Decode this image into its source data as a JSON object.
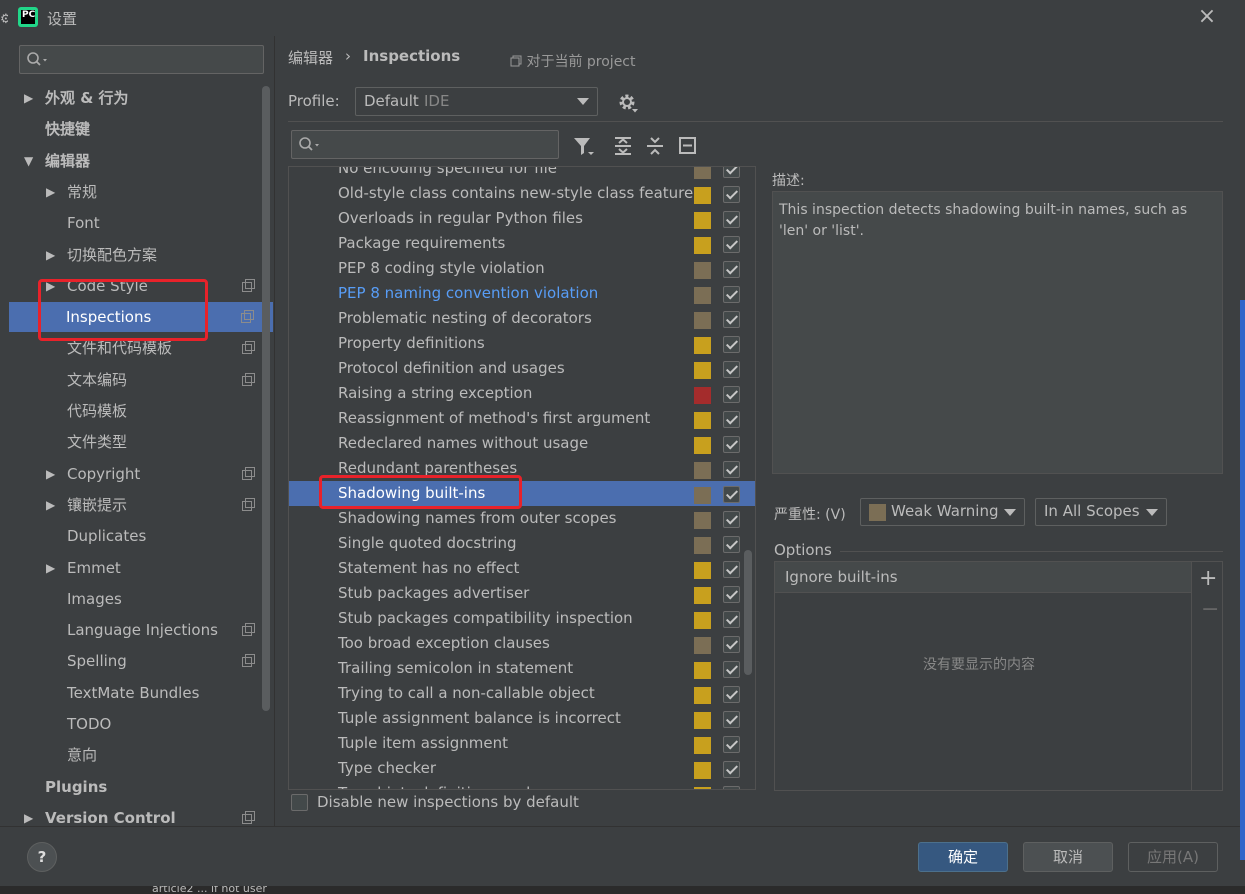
{
  "window": {
    "title": "设置"
  },
  "left": {
    "items": [
      {
        "label": "外观 & 行为",
        "bold": true,
        "arrow": "▶",
        "indent": 0,
        "copy": false
      },
      {
        "label": "快捷键",
        "bold": true,
        "arrow": "",
        "indent": 0,
        "copy": false
      },
      {
        "label": "编辑器",
        "bold": true,
        "arrow": "▼",
        "indent": 0,
        "copy": false
      },
      {
        "label": "常规",
        "bold": false,
        "arrow": "▶",
        "indent": 1,
        "copy": false
      },
      {
        "label": "Font",
        "bold": false,
        "arrow": "",
        "indent": 1,
        "copy": false
      },
      {
        "label": "切换配色方案",
        "bold": false,
        "arrow": "▶",
        "indent": 1,
        "copy": false
      },
      {
        "label": "Code Style",
        "bold": false,
        "arrow": "▶",
        "indent": 1,
        "copy": true
      },
      {
        "label": "Inspections",
        "bold": false,
        "arrow": "",
        "indent": 1,
        "copy": true,
        "selected": true
      },
      {
        "label": "文件和代码模板",
        "bold": false,
        "arrow": "",
        "indent": 1,
        "copy": true
      },
      {
        "label": "文本编码",
        "bold": false,
        "arrow": "",
        "indent": 1,
        "copy": true
      },
      {
        "label": "代码模板",
        "bold": false,
        "arrow": "",
        "indent": 1,
        "copy": false
      },
      {
        "label": "文件类型",
        "bold": false,
        "arrow": "",
        "indent": 1,
        "copy": false
      },
      {
        "label": "Copyright",
        "bold": false,
        "arrow": "▶",
        "indent": 1,
        "copy": true
      },
      {
        "label": "镶嵌提示",
        "bold": false,
        "arrow": "▶",
        "indent": 1,
        "copy": true
      },
      {
        "label": "Duplicates",
        "bold": false,
        "arrow": "",
        "indent": 1,
        "copy": false
      },
      {
        "label": "Emmet",
        "bold": false,
        "arrow": "▶",
        "indent": 1,
        "copy": false
      },
      {
        "label": "Images",
        "bold": false,
        "arrow": "",
        "indent": 1,
        "copy": false
      },
      {
        "label": "Language Injections",
        "bold": false,
        "arrow": "",
        "indent": 1,
        "copy": true
      },
      {
        "label": "Spelling",
        "bold": false,
        "arrow": "",
        "indent": 1,
        "copy": true
      },
      {
        "label": "TextMate Bundles",
        "bold": false,
        "arrow": "",
        "indent": 1,
        "copy": false
      },
      {
        "label": "TODO",
        "bold": false,
        "arrow": "",
        "indent": 1,
        "copy": false
      },
      {
        "label": "意向",
        "bold": false,
        "arrow": "",
        "indent": 1,
        "copy": false
      },
      {
        "label": "Plugins",
        "bold": true,
        "arrow": "",
        "indent": 0,
        "copy": false
      },
      {
        "label": "Version Control",
        "bold": true,
        "arrow": "▶",
        "indent": 0,
        "copy": true
      }
    ]
  },
  "breadcrumb": {
    "parent": "编辑器",
    "separator": "›",
    "current": "Inspections"
  },
  "scope_note": "对于当前 project",
  "profile": {
    "label": "Profile:",
    "value": "Default",
    "suffix": "IDE"
  },
  "inspections": [
    {
      "name": "No encoding specified for file",
      "sev": "#7b6e55"
    },
    {
      "name": "Old-style class contains new-style class features",
      "sev": "#c8a01e"
    },
    {
      "name": "Overloads in regular Python files",
      "sev": "#c8a01e"
    },
    {
      "name": "Package requirements",
      "sev": "#c8a01e"
    },
    {
      "name": "PEP 8 coding style violation",
      "sev": "#7b6e55"
    },
    {
      "name": "PEP 8 naming convention violation",
      "sev": "#7b6e55",
      "link": true
    },
    {
      "name": "Problematic nesting of decorators",
      "sev": "#7b6e55"
    },
    {
      "name": "Property definitions",
      "sev": "#c8a01e"
    },
    {
      "name": "Protocol definition and usages",
      "sev": "#c8a01e"
    },
    {
      "name": "Raising a string exception",
      "sev": "#a42c2c"
    },
    {
      "name": "Reassignment of method's first argument",
      "sev": "#c8a01e"
    },
    {
      "name": "Redeclared names without usage",
      "sev": "#c8a01e"
    },
    {
      "name": "Redundant parentheses",
      "sev": "#7b6e55"
    },
    {
      "name": "Shadowing built-ins",
      "sev": "#7b6e55",
      "selected": true
    },
    {
      "name": "Shadowing names from outer scopes",
      "sev": "#7b6e55"
    },
    {
      "name": "Single quoted docstring",
      "sev": "#7b6e55"
    },
    {
      "name": "Statement has no effect",
      "sev": "#c8a01e"
    },
    {
      "name": "Stub packages advertiser",
      "sev": "#c8a01e"
    },
    {
      "name": "Stub packages compatibility inspection",
      "sev": "#c8a01e"
    },
    {
      "name": "Too broad exception clauses",
      "sev": "#7b6e55"
    },
    {
      "name": "Trailing semicolon in statement",
      "sev": "#c8a01e"
    },
    {
      "name": "Trying to call a non-callable object",
      "sev": "#c8a01e"
    },
    {
      "name": "Tuple assignment balance is incorrect",
      "sev": "#c8a01e"
    },
    {
      "name": "Tuple item assignment",
      "sev": "#c8a01e"
    },
    {
      "name": "Type checker",
      "sev": "#c8a01e"
    },
    {
      "name": "Type hints definitions and usages",
      "sev": "#c8a01e"
    }
  ],
  "disable_label": "Disable new inspections by default",
  "description": {
    "label": "描述:",
    "text": "This inspection detects shadowing built-in names, such as 'len' or 'list'."
  },
  "severity": {
    "label": "严重性: (V)",
    "value": "Weak Warning",
    "swatch": "#7b6e55",
    "scope": "In All Scopes"
  },
  "options": {
    "label": "Options",
    "header": "Ignore built-ins",
    "empty": "没有要显示的内容",
    "plus": "+",
    "minus": "−"
  },
  "buttons": {
    "help": "?",
    "ok": "确定",
    "cancel": "取消",
    "apply": "应用(A)"
  },
  "bottom_text": "article2 ... if not user",
  "colors": {
    "selection": "#4b6eaf",
    "annotation": "#e8222a",
    "link": "#589df6"
  }
}
